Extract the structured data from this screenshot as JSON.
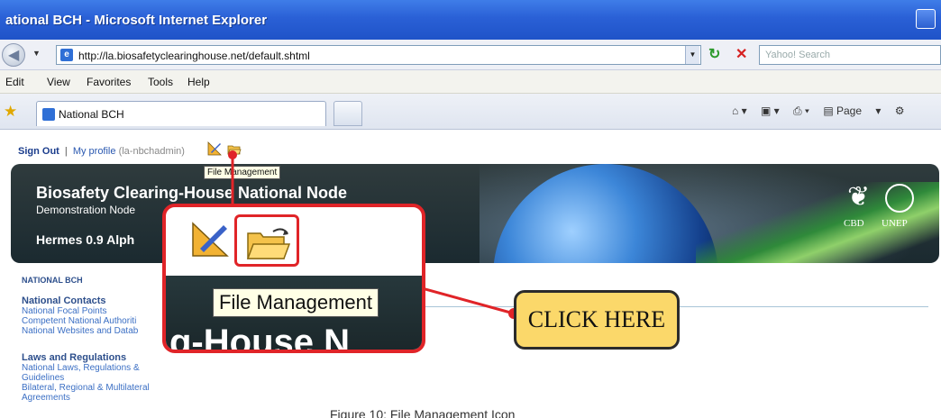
{
  "window": {
    "title": "ational BCH - Microsoft Internet Explorer"
  },
  "address_bar": {
    "url": "http://la.biosafetyclearinghouse.net/default.shtml",
    "search_placeholder": "Yahoo! Search"
  },
  "menu": [
    "Edit",
    "View",
    "Favorites",
    "Tools",
    "Help"
  ],
  "tab": {
    "label": "National BCH"
  },
  "toolbar_right": {
    "page_label": "Page"
  },
  "user_bar": {
    "sign_out": "Sign Out",
    "separator": "|",
    "my_profile": "My profile",
    "username": "(la-nbchadmin)"
  },
  "tooltip_small": "File Management",
  "banner": {
    "title": "Biosafety Clearing-House National Node",
    "subtitle": "Demonstration Node",
    "version": "Hermes 0.9 Alph",
    "cbd": "CBD",
    "unep": "UNEP"
  },
  "sidebar": {
    "header": "NATIONAL BCH",
    "sections": [
      {
        "title": "National Contacts",
        "links": [
          "National Focal Points",
          "Competent National Authoriti",
          "National Websites and Datab"
        ]
      },
      {
        "title": "Laws and Regulations",
        "links": [
          "National Laws, Regulations &",
          "Guidelines",
          "Bilateral, Regional & Multilateral",
          "Agreements"
        ]
      }
    ]
  },
  "zoom": {
    "tooltip": "File Management",
    "background_text": "g-House N"
  },
  "callout": {
    "label": "CLICK HERE"
  },
  "caption": "Figure 10: File Management Icon",
  "colors": {
    "highlight": "#e02428",
    "callout_fill": "#fbd86a",
    "titlebar": "#2a60d6"
  }
}
